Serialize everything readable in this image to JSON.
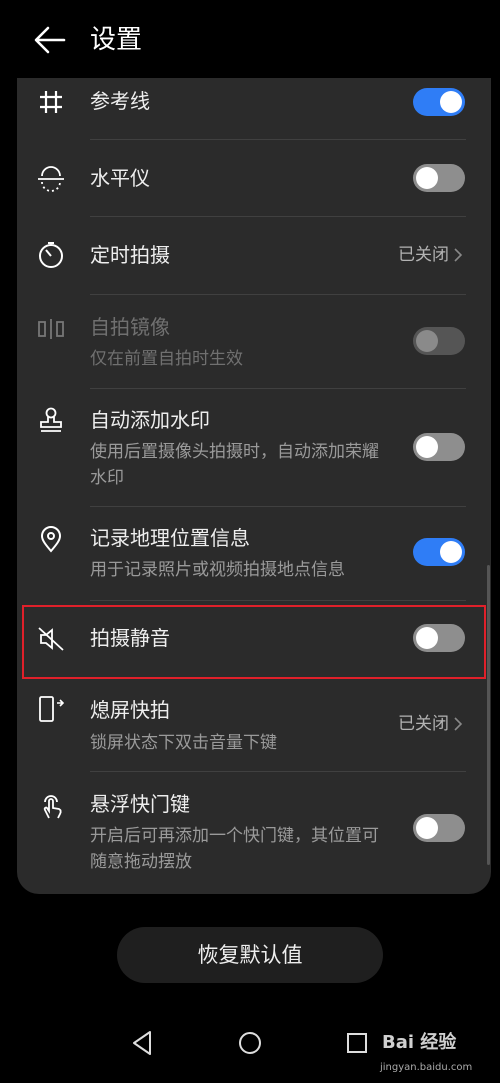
{
  "header": {
    "title": "设置"
  },
  "settings": {
    "grid": {
      "label": "参考线",
      "toggle": "on"
    },
    "level": {
      "label": "水平仪",
      "toggle": "off"
    },
    "timer": {
      "label": "定时拍摄",
      "value": "已关闭"
    },
    "mirror": {
      "label": "自拍镜像",
      "sub": "仅在前置自拍时生效",
      "toggle": "off-disabled"
    },
    "watermark": {
      "label": "自动添加水印",
      "sub": "使用后置摄像头拍摄时，自动添加荣耀水印",
      "toggle": "off"
    },
    "location": {
      "label": "记录地理位置信息",
      "sub": "用于记录照片或视频拍摄地点信息",
      "toggle": "on"
    },
    "mute": {
      "label": "拍摄静音",
      "toggle": "off"
    },
    "snapshot": {
      "label": "熄屏快拍",
      "sub": "锁屏状态下双击音量下键",
      "value": "已关闭"
    },
    "floating_shutter": {
      "label": "悬浮快门键",
      "sub": "开启后可再添加一个快门键，其位置可随意拖动摆放",
      "toggle": "off"
    }
  },
  "restore_button": {
    "label": "恢复默认值"
  },
  "watermark_text": {
    "brand": "Bai 经验",
    "url": "jingyan.baidu.com"
  },
  "colors": {
    "accent": "#2f7df6",
    "highlight": "#e0202a"
  }
}
